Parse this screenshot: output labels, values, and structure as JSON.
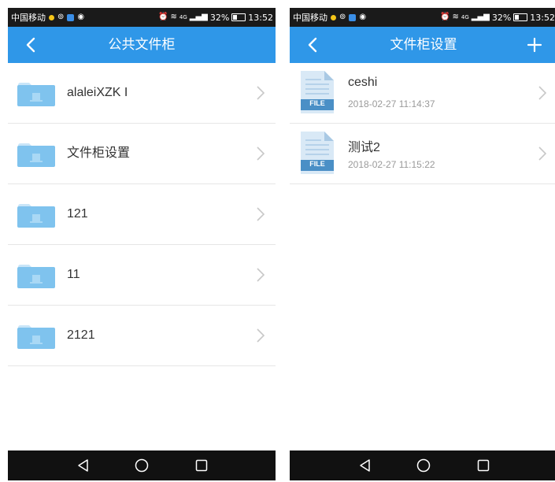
{
  "status_bar": {
    "carrier": "中国移动",
    "battery": "32%",
    "time": "13:52",
    "signal_text": "4G"
  },
  "left_screen": {
    "title": "公共文件柜",
    "folders": [
      {
        "label": "alaleiXZK I"
      },
      {
        "label": "文件柜设置"
      },
      {
        "label": "121"
      },
      {
        "label": "11"
      },
      {
        "label": "2121"
      }
    ]
  },
  "right_screen": {
    "title": "文件柜设置",
    "files": [
      {
        "name": "ceshi",
        "date": "2018-02-27 11:14:37",
        "badge": "FILE"
      },
      {
        "name": "测试2",
        "date": "2018-02-27 11:15:22",
        "badge": "FILE"
      }
    ]
  },
  "icons": {
    "back": "chevron-left-icon",
    "add": "plus-icon",
    "folder": "folder-icon",
    "file": "file-icon",
    "chevron": "chevron-right-icon",
    "nav_back": "triangle-back-icon",
    "nav_home": "circle-home-icon",
    "nav_recent": "square-recent-icon"
  },
  "colors": {
    "header": "#2f97e8",
    "status_bar": "#1a1a1a",
    "nav_bar": "#111111",
    "folder": "#7fc3ee",
    "file_badge": "#4a8fc6"
  }
}
